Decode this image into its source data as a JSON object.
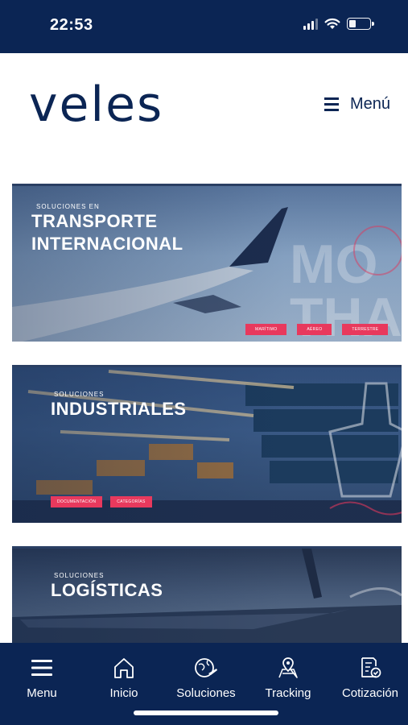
{
  "status_bar": {
    "time": "22:53"
  },
  "header": {
    "logo": "veles",
    "menu_label": "Menú"
  },
  "cards": [
    {
      "eyebrow": "SOLUCIONES EN",
      "title": "TRANSPORTE\nINTERNACIONAL",
      "tags": [
        "MARÍTIMO",
        "AÉREO",
        "TERRESTRE"
      ],
      "watermark": "MO\nTHA"
    },
    {
      "eyebrow": "SOLUCIONES",
      "title": "INDUSTRIALES",
      "tags": [
        "DOCUMENTACIÓN",
        "CATEGORÍAS"
      ]
    },
    {
      "eyebrow": "SOLUCIONES",
      "title": "LOGÍSTICAS",
      "tags": []
    }
  ],
  "bottom_nav": [
    {
      "label": "Menu",
      "icon": "menu-icon"
    },
    {
      "label": "Inicio",
      "icon": "home-icon"
    },
    {
      "label": "Soluciones",
      "icon": "globe-plane-icon"
    },
    {
      "label": "Tracking",
      "icon": "map-pin-icon"
    },
    {
      "label": "Cotización",
      "icon": "quote-document-icon"
    }
  ],
  "colors": {
    "brand": "#0b2554",
    "accent": "#e8395d",
    "text_on_dark": "#ffffff"
  }
}
